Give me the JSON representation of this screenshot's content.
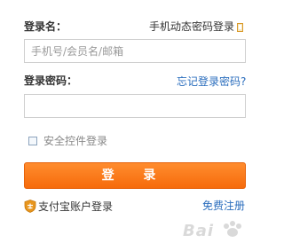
{
  "form": {
    "username_label": "登录名：",
    "phone_login_link": "手机动态密码登录",
    "username_placeholder": "手机号/会员名/邮箱",
    "password_label": "登录密码：",
    "forgot_password_link": "忘记登录密码?",
    "password_value": "",
    "secure_control_label": "安全控件登录",
    "secure_control_checked": false,
    "login_button": "登 录",
    "alipay_login_link": "支付宝账户登录",
    "register_link": "免费注册"
  },
  "watermark": {
    "text": "Bai"
  },
  "colors": {
    "button": "#f97a16",
    "link": "#2a6dbd",
    "alipay_shield": "#e8961e"
  },
  "icons": {
    "phone": "phone-icon",
    "alipay": "alipay-shield-icon",
    "checkbox": "checkbox"
  }
}
